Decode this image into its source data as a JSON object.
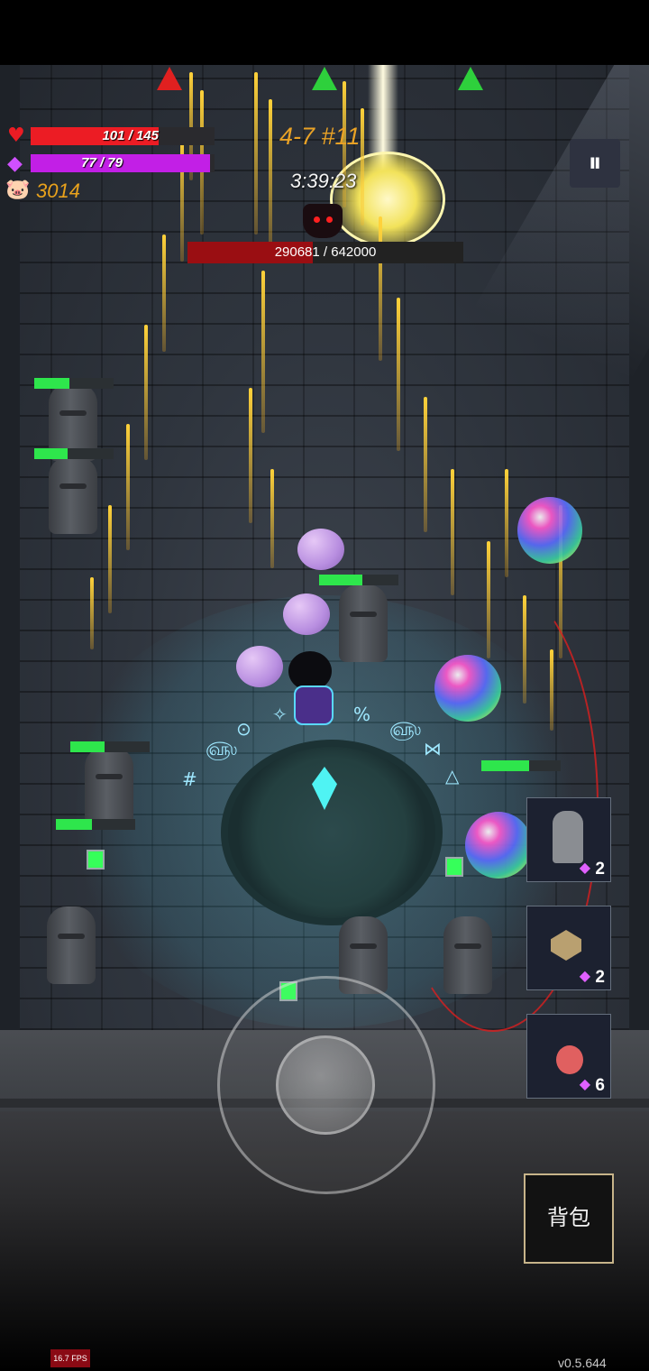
{
  "hud": {
    "hp": {
      "text": "101 / 145",
      "current": 101,
      "max": 145,
      "color": "#ec1c24",
      "icon": "heart-icon"
    },
    "mp": {
      "text": "77 / 79",
      "current": 77,
      "max": 79,
      "color": "#c21fe6",
      "icon": "diamond-icon"
    },
    "coins": {
      "value": "3014",
      "icon": "pig-icon"
    },
    "level": "4-7 #11",
    "timer": "3:39:23",
    "boss_hp": {
      "text": "290681 / 642000",
      "current": 290681,
      "max": 642000,
      "color": "#9a0e12"
    },
    "pause_icon": "pause-icon"
  },
  "indicators": [
    {
      "color": "#e02020",
      "icon": "enemy-direction-indicator"
    },
    {
      "color": "#2ed03c",
      "icon": "ally-direction-indicator"
    },
    {
      "color": "#2ed03c",
      "icon": "ally-direction-indicator"
    }
  ],
  "enemies": {
    "statue_hp_fractions": [
      0.44,
      0.42,
      0.43,
      0.45,
      0.55,
      0.6
    ]
  },
  "inventory": {
    "slots": [
      {
        "item": "statue-item-icon",
        "count": "2"
      },
      {
        "item": "crystal-die-item-icon",
        "count": "2"
      },
      {
        "item": "potion-item-icon",
        "count": "6"
      }
    ]
  },
  "controls": {
    "bag_label": "背包",
    "joystick": "virtual-joystick"
  },
  "footer": {
    "fps": "16.7 FPS",
    "version": "v0.5.644"
  }
}
